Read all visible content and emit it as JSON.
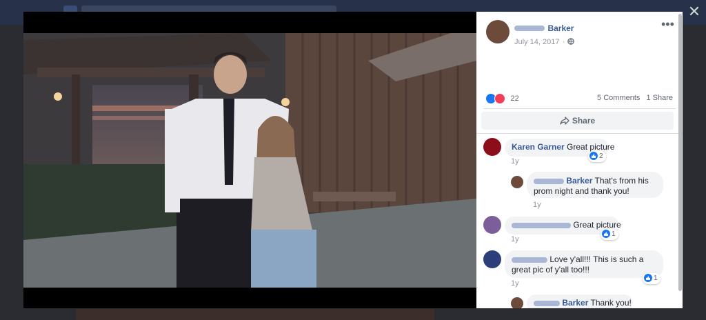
{
  "post": {
    "author_last": "Barker",
    "date": "July 14, 2017",
    "reactions_count": "22",
    "comments_count": "5 Comments",
    "shares_count": "1 Share",
    "share_label": "Share"
  },
  "comments": [
    {
      "author": "Karen Garner",
      "text": "Great picture",
      "ago": "1y",
      "likes": "2"
    },
    {
      "author": "Barker",
      "text": "That's from his prom night and thank you!",
      "ago": "1y",
      "likes": ""
    },
    {
      "author": "",
      "text": "Great picture",
      "ago": "1y",
      "likes": "1"
    },
    {
      "author": "",
      "text": "Love y'all!!! This is such a great pic of y'all too!!!",
      "ago": "1y",
      "likes": "1"
    },
    {
      "author": "Barker",
      "text": "Thank you!",
      "ago": "",
      "likes": ""
    }
  ],
  "colors": {
    "accent": "#385898",
    "like": "#1877f2",
    "love": "#f33e58"
  },
  "icons": [
    "close-icon",
    "more-icon",
    "globe-icon",
    "like-icon",
    "love-icon",
    "share-icon"
  ]
}
